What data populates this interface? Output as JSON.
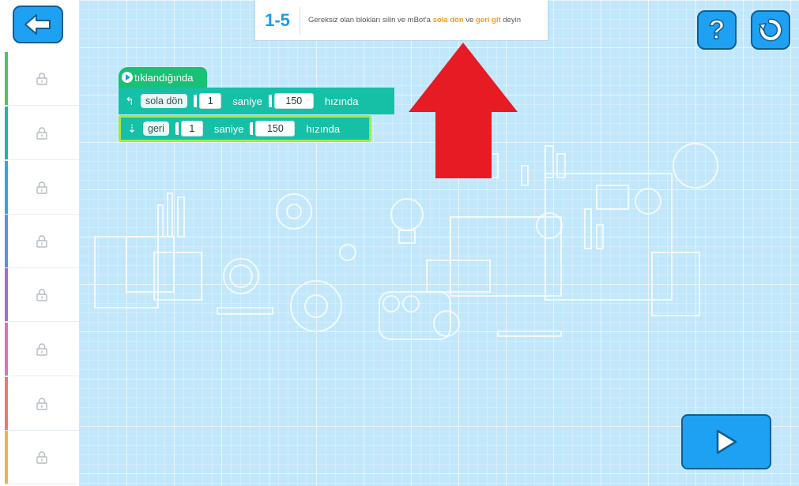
{
  "instruction": {
    "level": "1-5",
    "text_before": "Gereksiz olan blokları silin ve mBot'a ",
    "highlight1": "sola dön",
    "text_middle": " ve ",
    "highlight2": "geri git",
    "text_after": " deyin"
  },
  "sidebar": {
    "slots": [
      {
        "color": "#4cc65a"
      },
      {
        "color": "#1ab8a5"
      },
      {
        "color": "#29a9e8"
      },
      {
        "color": "#5b8fe8"
      },
      {
        "color": "#a36ad8"
      },
      {
        "color": "#e26eb6"
      },
      {
        "color": "#f2756e"
      },
      {
        "color": "#f6b13b"
      }
    ],
    "lock_icon": "lock-icon"
  },
  "blocks": {
    "hat_label": "tıklandığında",
    "block1": {
      "action": "sola dön",
      "duration": "1",
      "duration_unit": "saniye",
      "speed": "150",
      "speed_unit": "hızında"
    },
    "block2": {
      "action": "geri",
      "duration": "1",
      "duration_unit": "saniye",
      "speed": "150",
      "speed_unit": "hızında"
    }
  },
  "colors": {
    "accent": "#1ea1f2",
    "block_green": "#16c0a6",
    "hat_green": "#18c173",
    "highlight_orange": "#f39a1e",
    "arrow_red": "#e61b23"
  },
  "help_button": {
    "label": "?"
  }
}
